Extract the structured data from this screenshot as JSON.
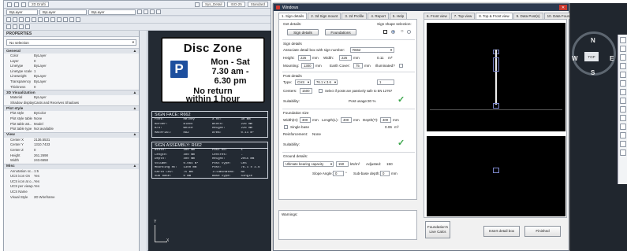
{
  "cad": {
    "title_dd1": "2D Drafti",
    "title_dd2": "Sys_Detail",
    "title_dd3": "ISO-25",
    "title_dd4": "Standard",
    "layer_dd": "ByLayer",
    "color_dd": "ByLayer",
    "linetype_dd": "ByLayer",
    "properties_title": "PROPERTIES",
    "selection": "No selection",
    "groups": [
      {
        "name": "General",
        "rows": [
          {
            "k": "Color",
            "v": "ByLayer"
          },
          {
            "k": "Layer",
            "v": "0"
          },
          {
            "k": "Linetype",
            "v": "ByLayer"
          },
          {
            "k": "Linetype scale",
            "v": "1"
          },
          {
            "k": "Lineweight",
            "v": "ByLayer"
          },
          {
            "k": "Transparency",
            "v": "ByLayer"
          },
          {
            "k": "Thickness",
            "v": "0"
          }
        ]
      },
      {
        "name": "3D Visualization",
        "rows": [
          {
            "k": "Material",
            "v": "ByLayer"
          },
          {
            "k": "Shadow display",
            "v": "Casts and Receives Shadows"
          }
        ]
      },
      {
        "name": "Plot style",
        "rows": [
          {
            "k": "Plot style",
            "v": "ByColor"
          },
          {
            "k": "Plot style table",
            "v": "None"
          },
          {
            "k": "Plot table att...",
            "v": "Model"
          },
          {
            "k": "Plot table type",
            "v": "Not available"
          }
        ]
      },
      {
        "name": "View",
        "rows": [
          {
            "k": "Center X",
            "v": "2136.5531"
          },
          {
            "k": "Center Y",
            "v": "1310.7433"
          },
          {
            "k": "Center Z",
            "v": "0"
          },
          {
            "k": "Height",
            "v": "261.2698"
          },
          {
            "k": "Width",
            "v": "243.6558"
          }
        ]
      },
      {
        "name": "Misc",
        "rows": [
          {
            "k": "Annotation sc...",
            "v": "1:5"
          },
          {
            "k": "UCS icon On",
            "v": "Yes"
          },
          {
            "k": "UCS icon at o...",
            "v": "Yes"
          },
          {
            "k": "UCS per viewp...",
            "v": "Yes"
          },
          {
            "k": "UCS Name",
            "v": ""
          },
          {
            "k": "Visual Style",
            "v": "2D Wireframe"
          }
        ]
      }
    ],
    "sign": {
      "title": "Disc Zone",
      "p": "P",
      "line1": "Mon - Sat",
      "line2": "7.30 am -",
      "line3": "6.30 pm",
      "line4": "No return",
      "line5": "within 1 hour"
    },
    "face_table": {
      "title": "SIGN FACE: R662",
      "rows": [
        [
          "Font:",
          "Helvey",
          "X ht:",
          "30 mm"
        ],
        [
          "Border:",
          "Black",
          "Width:",
          "226 mm"
        ],
        [
          "B/G:",
          "White",
          "Height:",
          "226 mm"
        ],
        [
          "Material:",
          "RA2",
          "Area:",
          "0.11 m²"
        ]
      ]
    },
    "asm_table": {
      "title": "SIGN ASSEMBLY: R662",
      "rows": [
        [
          "Width:",
          "300 mm",
          "Post no:",
          "1"
        ],
        [
          "Length:",
          "400 mm",
          "Centres:",
          "-"
        ],
        [
          "Depth:",
          "400 mm",
          "Height:",
          "2055 mm"
        ],
        [
          "Volume:",
          "0.064 m³",
          "Post type:",
          "CHS"
        ],
        [
          "Mounting Ht:",
          "1300 mm",
          "Post:",
          "76.1 x 3.6"
        ],
        [
          "Earth Cov:",
          "75 mm",
          "Illuminated:",
          "No"
        ],
        [
          "Sub base:",
          "0 mm",
          "Base type:",
          "Single"
        ]
      ]
    },
    "ucs_y": "Y",
    "ucs_x": "X"
  },
  "dialog": {
    "title": "Windows",
    "left_tabs": [
      "1. Sign details",
      "2. 3d Sign mount",
      "3. 2d Profile",
      "4. Report",
      "5. Help"
    ],
    "right_tabs": [
      "6. Front view",
      "7. Top view",
      "8. Top & Front view",
      "9. Data Post(s)",
      "10. Data Foundations"
    ],
    "get_details_lbl": "Get details:",
    "sign_details_btn": "Sign details",
    "foundations_btn": "Foundations",
    "sign_shape_lbl": "Sign shape selection:",
    "sign_details_section": "Sign details",
    "assoc_lbl": "Associate detail box with sign number:",
    "assoc_val": "R662",
    "height_lbl": "Height:",
    "height_val": "226",
    "width_lbl": "Width:",
    "width_val": "226",
    "area_val": "0.11",
    "area_unit": "m²",
    "mm": "mm",
    "mounting_lbl": "Mounting:",
    "mounting_val": "1300",
    "earth_lbl": "Earth Cover:",
    "earth_val": "75",
    "illum_lbl": "Illuminated?",
    "post_section": "Post details",
    "type_lbl": "Type:",
    "type_val": "CHS",
    "size_val": "76.1 x 3.6",
    "count_val": "1",
    "centers_lbl": "Centers:",
    "centers_val": "1500",
    "passive_lbl": "Select if posts are passively safe to EN 12767",
    "suit_lbl": "Suitability:",
    "post_usage_lbl": "Post usage:",
    "post_usage_val": "30 %",
    "found_section": "Foundation size",
    "width_h_lbl": "Width(H):",
    "width_h_val": "300",
    "length_l_lbl": "Length(L):",
    "length_l_val": "400",
    "depth_lbl": "Depth(T):",
    "depth_val": "400",
    "single_base_lbl": "Single base",
    "vol_val": "0.06",
    "vol_unit": "m³",
    "reinf_lbl": "Reinforcement:",
    "reinf_val": "None",
    "suit2_lbl": "Suitability:",
    "ground_section": "Ground details:",
    "bearing_val": "Ultimate bearing capacity",
    "bearing_num": "150",
    "bearing_unit": "kN/m²",
    "adjusted_lbl": "Adjusted:",
    "adjusted_val": "150",
    "slope_lbl": "Slope Angle:",
    "slope_val": "0",
    "subbase_lbl": "Sub-base depth:",
    "subbase_val": "0",
    "warnings_lbl": "Warnings:",
    "foundations_live_btn": "Foundation's Live Calcs",
    "insert_btn": "Insert detail box",
    "finished_btn": "Finished"
  },
  "nav": {
    "n": "N",
    "e": "E",
    "s": "S",
    "w": "W",
    "top": "TOP"
  },
  "colors": {
    "accent": "#2d3a4f",
    "sign_blue": "#1d4f9e",
    "tick_green": "#3aa64a",
    "teal": "#0f7f86"
  }
}
